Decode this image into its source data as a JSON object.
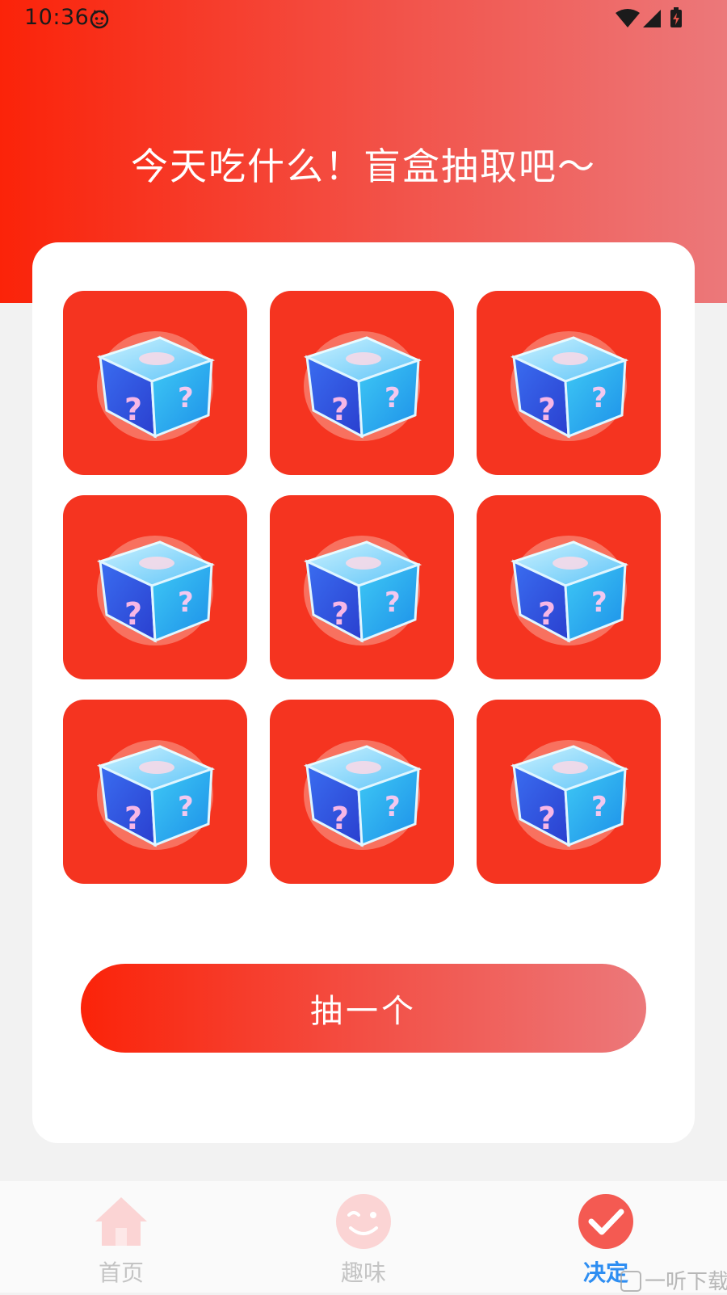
{
  "status_bar": {
    "time": "10:36",
    "icons": [
      "cat-notification-icon",
      "wifi-icon",
      "cell-signal-icon",
      "battery-charging-icon"
    ]
  },
  "header": {
    "title": "今天吃什么！盲盒抽取吧～",
    "gradient": [
      "#fb2309",
      "#ec787a"
    ]
  },
  "blind_boxes": {
    "icon": "blind-box-cube-icon",
    "tile_color": "#f53420",
    "count": 9
  },
  "draw_button": {
    "label": "抽一个"
  },
  "bottom_nav": {
    "items": [
      {
        "label": "首页",
        "icon": "home-icon",
        "active": false
      },
      {
        "label": "趣味",
        "icon": "wink-face-icon",
        "active": false
      },
      {
        "label": "决定",
        "icon": "checkmark-icon",
        "active": true
      }
    ],
    "active_color": "#2e8ef2",
    "inactive_color": "#c4c4c4"
  },
  "watermark": {
    "text": "一听下载"
  }
}
